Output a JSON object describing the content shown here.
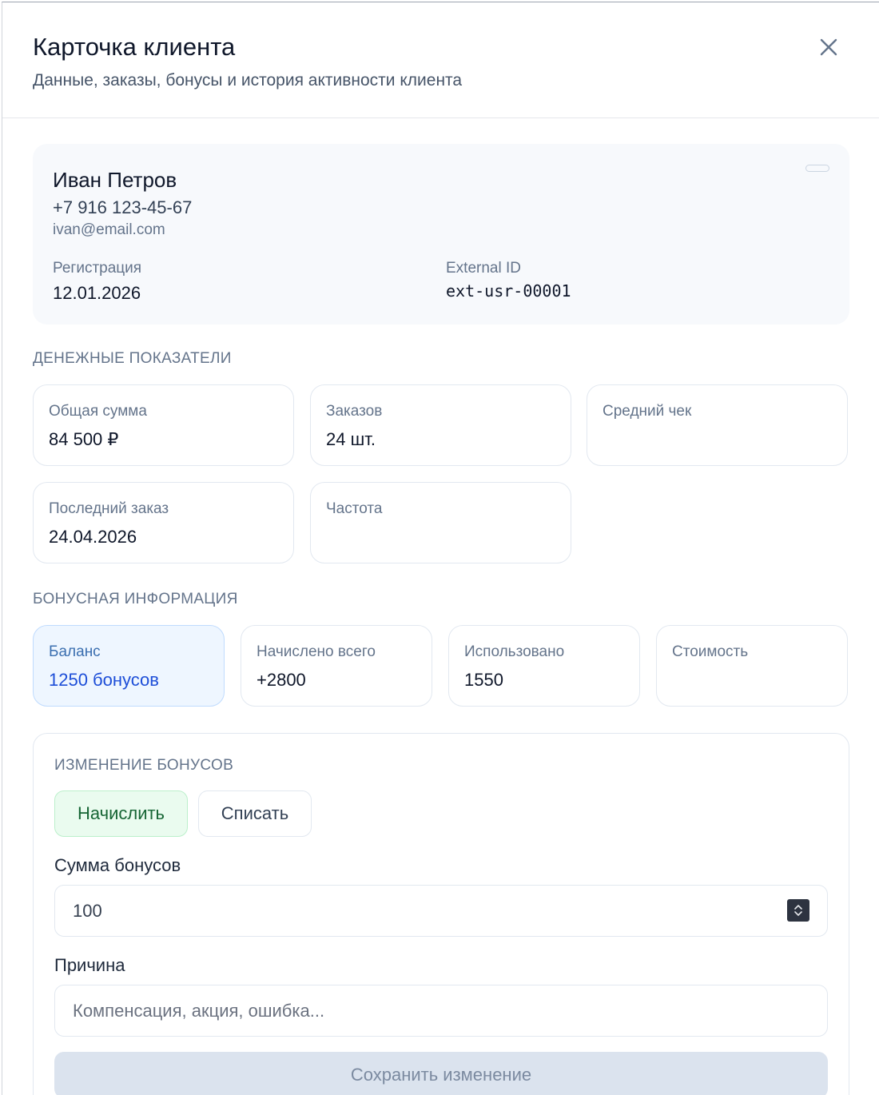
{
  "header": {
    "title": "Карточка клиента",
    "subtitle": "Данные, заказы, бонусы и история активности клиента",
    "close_icon": "close-icon"
  },
  "client": {
    "name": "Иван Петров",
    "phone": "+7 916 123-45-67",
    "email": "ivan@email.com",
    "registration_label": "Регистрация",
    "registration_date": "12.01.2026",
    "external_id_label": "External ID",
    "external_id": "ext-usr-00001"
  },
  "money": {
    "section_title": "ДЕНЕЖНЫЕ ПОКАЗАТЕЛИ",
    "cards": [
      {
        "label": "Общая сумма",
        "value": "84 500 ₽"
      },
      {
        "label": "Заказов",
        "value": "24 шт."
      },
      {
        "label": "Средний чек",
        "value": ""
      },
      {
        "label": "Последний заказ",
        "value": "24.04.2026"
      },
      {
        "label": "Частота",
        "value": ""
      }
    ]
  },
  "bonus": {
    "section_title": "БОНУСНАЯ ИНФОРМАЦИЯ",
    "cards": [
      {
        "label": "Баланс",
        "value": "1250 бонусов"
      },
      {
        "label": "Начислено всего",
        "value": "+2800"
      },
      {
        "label": "Использовано",
        "value": "1550"
      },
      {
        "label": "Стоимость",
        "value": ""
      }
    ]
  },
  "bonus_change": {
    "title": "ИЗМЕНЕНИЕ БОНУСОВ",
    "accrue_label": "Начислить",
    "writeoff_label": "Списать",
    "active_mode": "accrue",
    "amount_label": "Сумма бонусов",
    "amount_value": "100",
    "reason_label": "Причина",
    "reason_placeholder": "Компенсация, акция, ошибка...",
    "save_label": "Сохранить изменение"
  },
  "colors": {
    "accent_blue": "#1d4ed8",
    "accent_green": "#166534",
    "disabled_bg": "#dbe3ee"
  }
}
